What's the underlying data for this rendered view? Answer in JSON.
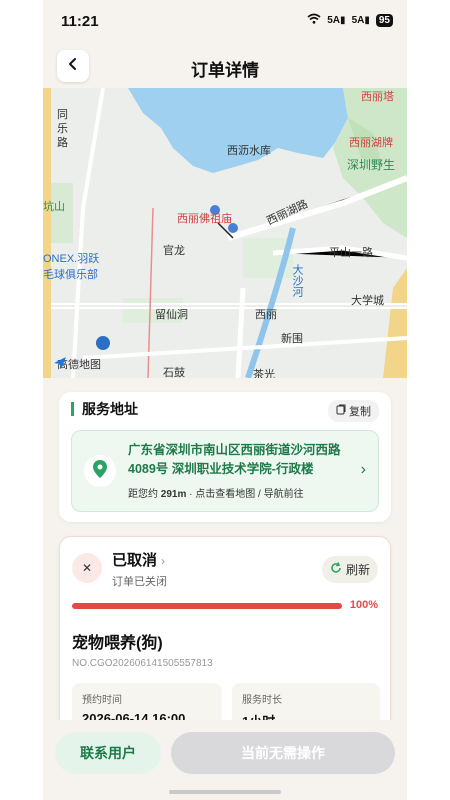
{
  "status_bar": {
    "time": "11:21",
    "signal_1": "5A",
    "signal_2": "5A",
    "battery": "95"
  },
  "header": {
    "title": "订单详情"
  },
  "map": {
    "labels": {
      "tong": "同",
      "le": "乐",
      "lu": "路",
      "xilita": "西丽塔",
      "xilihupai": "西丽湖牌",
      "shenzhenye": "深圳野生",
      "xilishuiku": "西沥水库",
      "kengshan": "坑山",
      "xilifoshimiao": "西丽佛祖庙",
      "xilihulu": "西丽湖路",
      "guanlong": "官龙",
      "pingshanyilu": "平山一路",
      "onex": "ONEX.羽跃",
      "maoqiu": "毛球俱乐部",
      "dashahe": "大沙河",
      "daxuecheng": "大学城",
      "liuxiandong": "留仙洞",
      "xili_station": "西丽",
      "xinwei": "新围",
      "shigu": "石鼓",
      "chaguang": "茶光"
    },
    "brand": "高德地图"
  },
  "address": {
    "section_title": "服务地址",
    "copy_label": "复制",
    "full_address": "广东省深圳市南山区西丽街道沙河西路4089号 深圳职业技术学院-行政楼",
    "distance_prefix": "距您约",
    "distance": "291m",
    "hint": "· 点击查看地图 / 导航前往"
  },
  "order": {
    "status_title": "已取消",
    "status_sub": "订单已关闭",
    "refresh_label": "刷新",
    "progress_percent": 100,
    "progress_label": "100%",
    "service_name": "宠物喂养(狗)",
    "order_no": "NO.CGO202606141505557813",
    "booking_time_label": "预约时间",
    "booking_time": "2026-06-14 16:00",
    "duration_label": "服务时长",
    "duration": "1小时"
  },
  "actions": {
    "contact_label": "联系用户",
    "noop_label": "当前无需操作"
  },
  "colors": {
    "accent_green": "#2aa465",
    "cancel_red": "#e34a45",
    "water": "#9fd0f0",
    "park": "#cde8c8"
  },
  "icons": {
    "back": "chevron-left-icon",
    "copy": "copy-icon",
    "pin": "location-pin-icon",
    "close": "close-icon",
    "refresh": "refresh-icon"
  }
}
